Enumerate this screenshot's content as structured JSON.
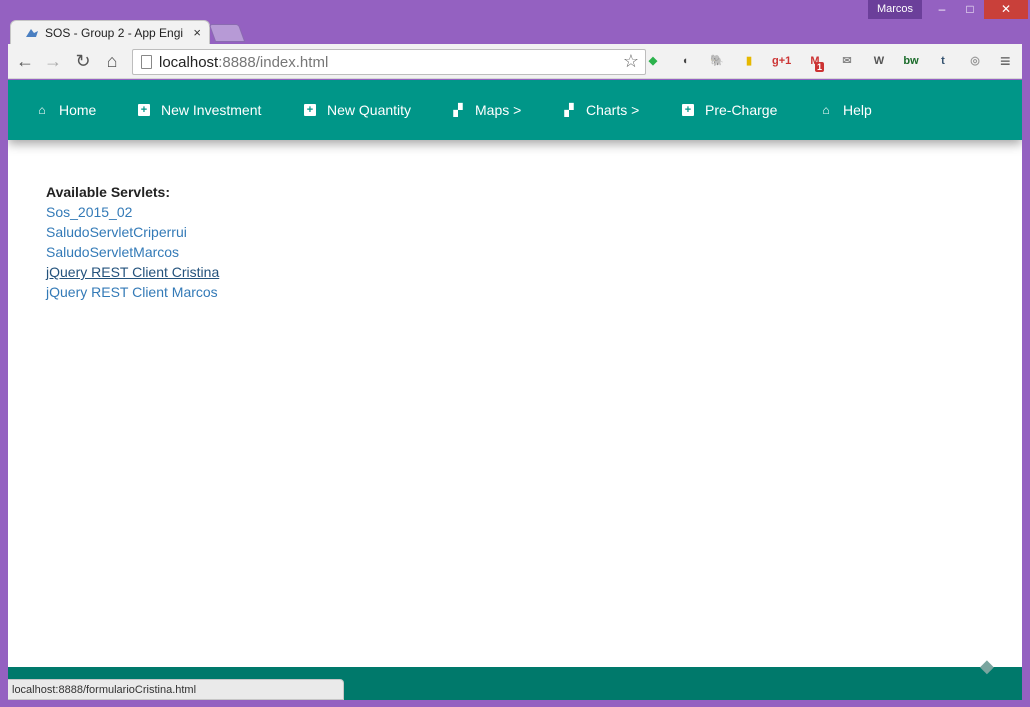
{
  "window": {
    "user": "Marcos",
    "minimize": "–",
    "maximize": "□",
    "close": "✕"
  },
  "tab": {
    "title": "SOS - Group 2 - App Engi",
    "close": "×"
  },
  "toolbar": {
    "back": "←",
    "forward": "→",
    "reload": "↻",
    "home": "⌂",
    "url_host": "localhost",
    "url_rest": ":8888/index.html",
    "star": "☆",
    "menu": "≡",
    "extensions": [
      {
        "name": "feedly-icon",
        "glyph": "◆",
        "color": "#2bb24c"
      },
      {
        "name": "pocket-icon",
        "glyph": "◖",
        "color": "#444"
      },
      {
        "name": "evernote-icon",
        "glyph": "🐘",
        "color": "#444"
      },
      {
        "name": "pushbullet-icon",
        "glyph": "▮",
        "color": "#e6b800"
      },
      {
        "name": "google-plus-icon",
        "glyph": "g+1",
        "color": "#c33"
      },
      {
        "name": "gmail-icon",
        "glyph": "M",
        "color": "#c33"
      },
      {
        "name": "mail-icon",
        "glyph": "✉",
        "color": "#888"
      },
      {
        "name": "wikipedia-icon",
        "glyph": "W",
        "color": "#555"
      },
      {
        "name": "bw-icon",
        "glyph": "bw",
        "color": "#1a6b2a"
      },
      {
        "name": "tumblr-icon",
        "glyph": "t",
        "color": "#34526f"
      },
      {
        "name": "wheel-icon",
        "glyph": "◎",
        "color": "#999"
      }
    ],
    "gmail_badge": "1"
  },
  "navbar": {
    "items": [
      {
        "label": "Home",
        "icon": "home-icon"
      },
      {
        "label": "New Investment",
        "icon": "plus-icon"
      },
      {
        "label": "New Quantity",
        "icon": "plus-icon"
      },
      {
        "label": "Maps >",
        "icon": "billboard-icon"
      },
      {
        "label": "Charts >",
        "icon": "billboard-icon"
      },
      {
        "label": "Pre-Charge",
        "icon": "plus-icon"
      },
      {
        "label": "Help",
        "icon": "home-icon"
      }
    ]
  },
  "content": {
    "title": "Available Servlets:",
    "links": [
      "Sos_2015_02",
      "SaludoServletCriperrui",
      "SaludoServletMarcos",
      "jQuery REST Client Cristina",
      "jQuery REST Client Marcos"
    ]
  },
  "status_bar": {
    "url": "localhost:8888/formularioCristina.html"
  }
}
